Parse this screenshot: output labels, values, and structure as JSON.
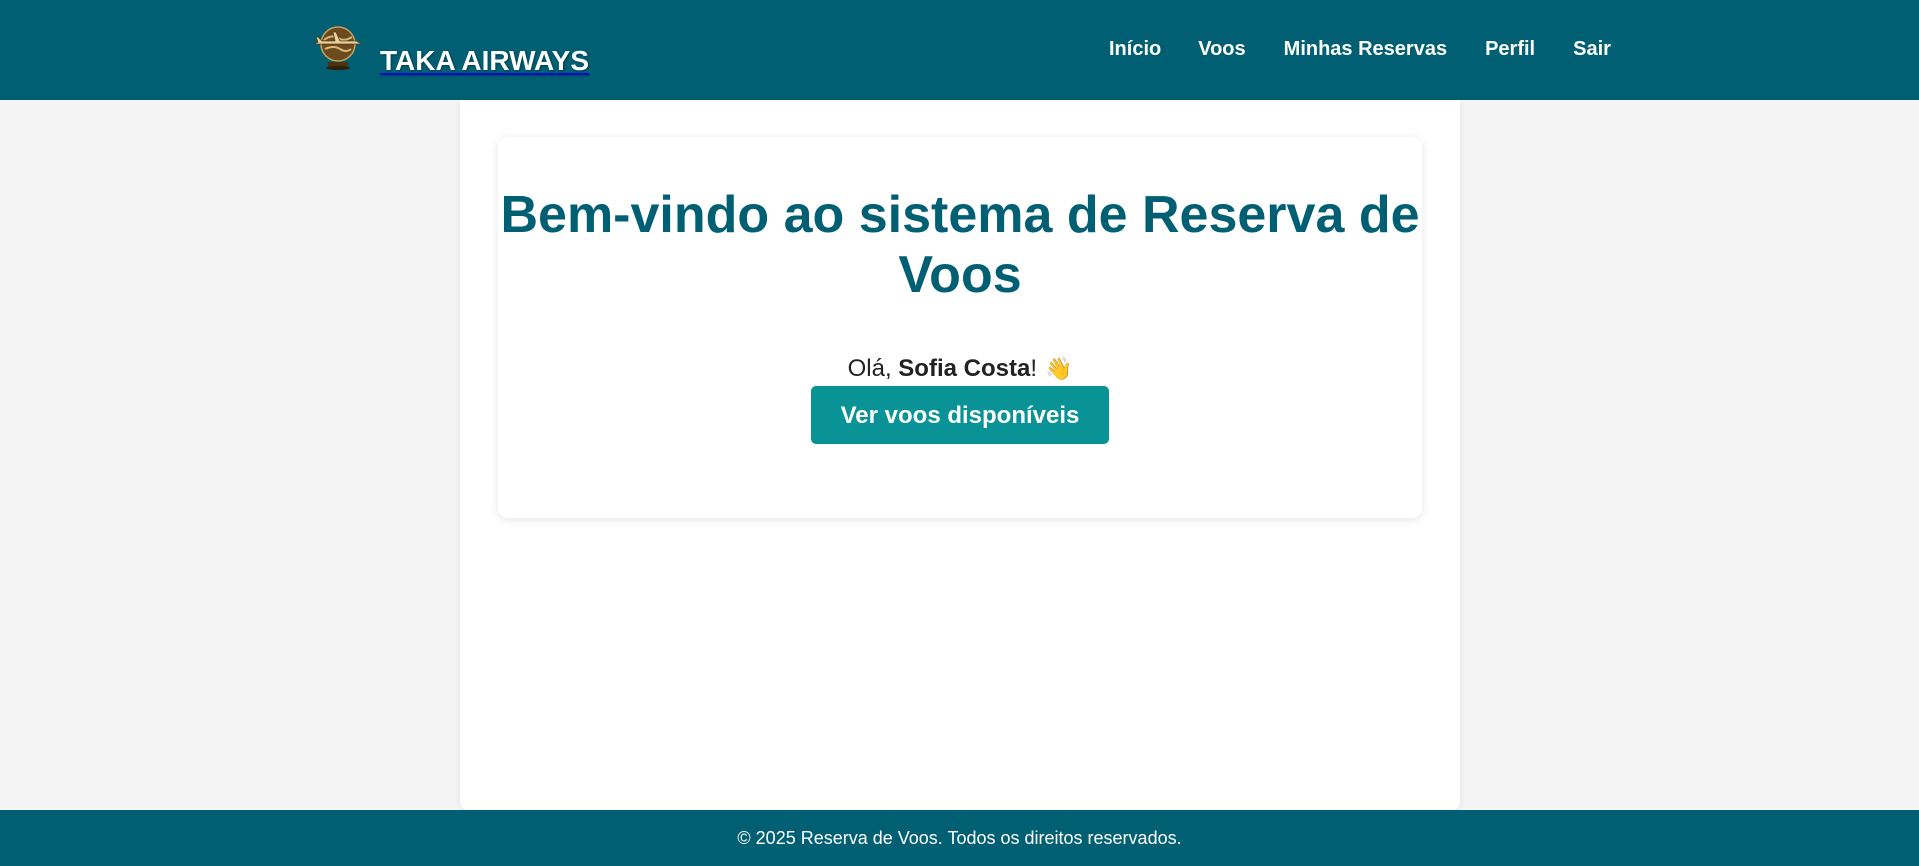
{
  "header": {
    "brand": "TAKA AIRWAYS",
    "logo_icon": "globe-airplane-logo-icon",
    "nav": [
      {
        "label": "Início"
      },
      {
        "label": "Voos"
      },
      {
        "label": "Minhas Reservas"
      },
      {
        "label": "Perfil"
      },
      {
        "label": "Sair"
      }
    ]
  },
  "main": {
    "title": "Bem-vindo ao sistema de Reserva de Voos",
    "greeting_prefix": "Olá, ",
    "user_name": "Sofia Costa",
    "greeting_suffix": "!",
    "wave_icon": "👋",
    "cta_label": "Ver voos disponíveis"
  },
  "footer": {
    "text": "© 2025 Reserva de Voos. Todos os direitos reservados."
  },
  "colors": {
    "primary": "#005f73",
    "accent": "#0a9396",
    "background": "#f4f4f4",
    "card": "#ffffff"
  }
}
